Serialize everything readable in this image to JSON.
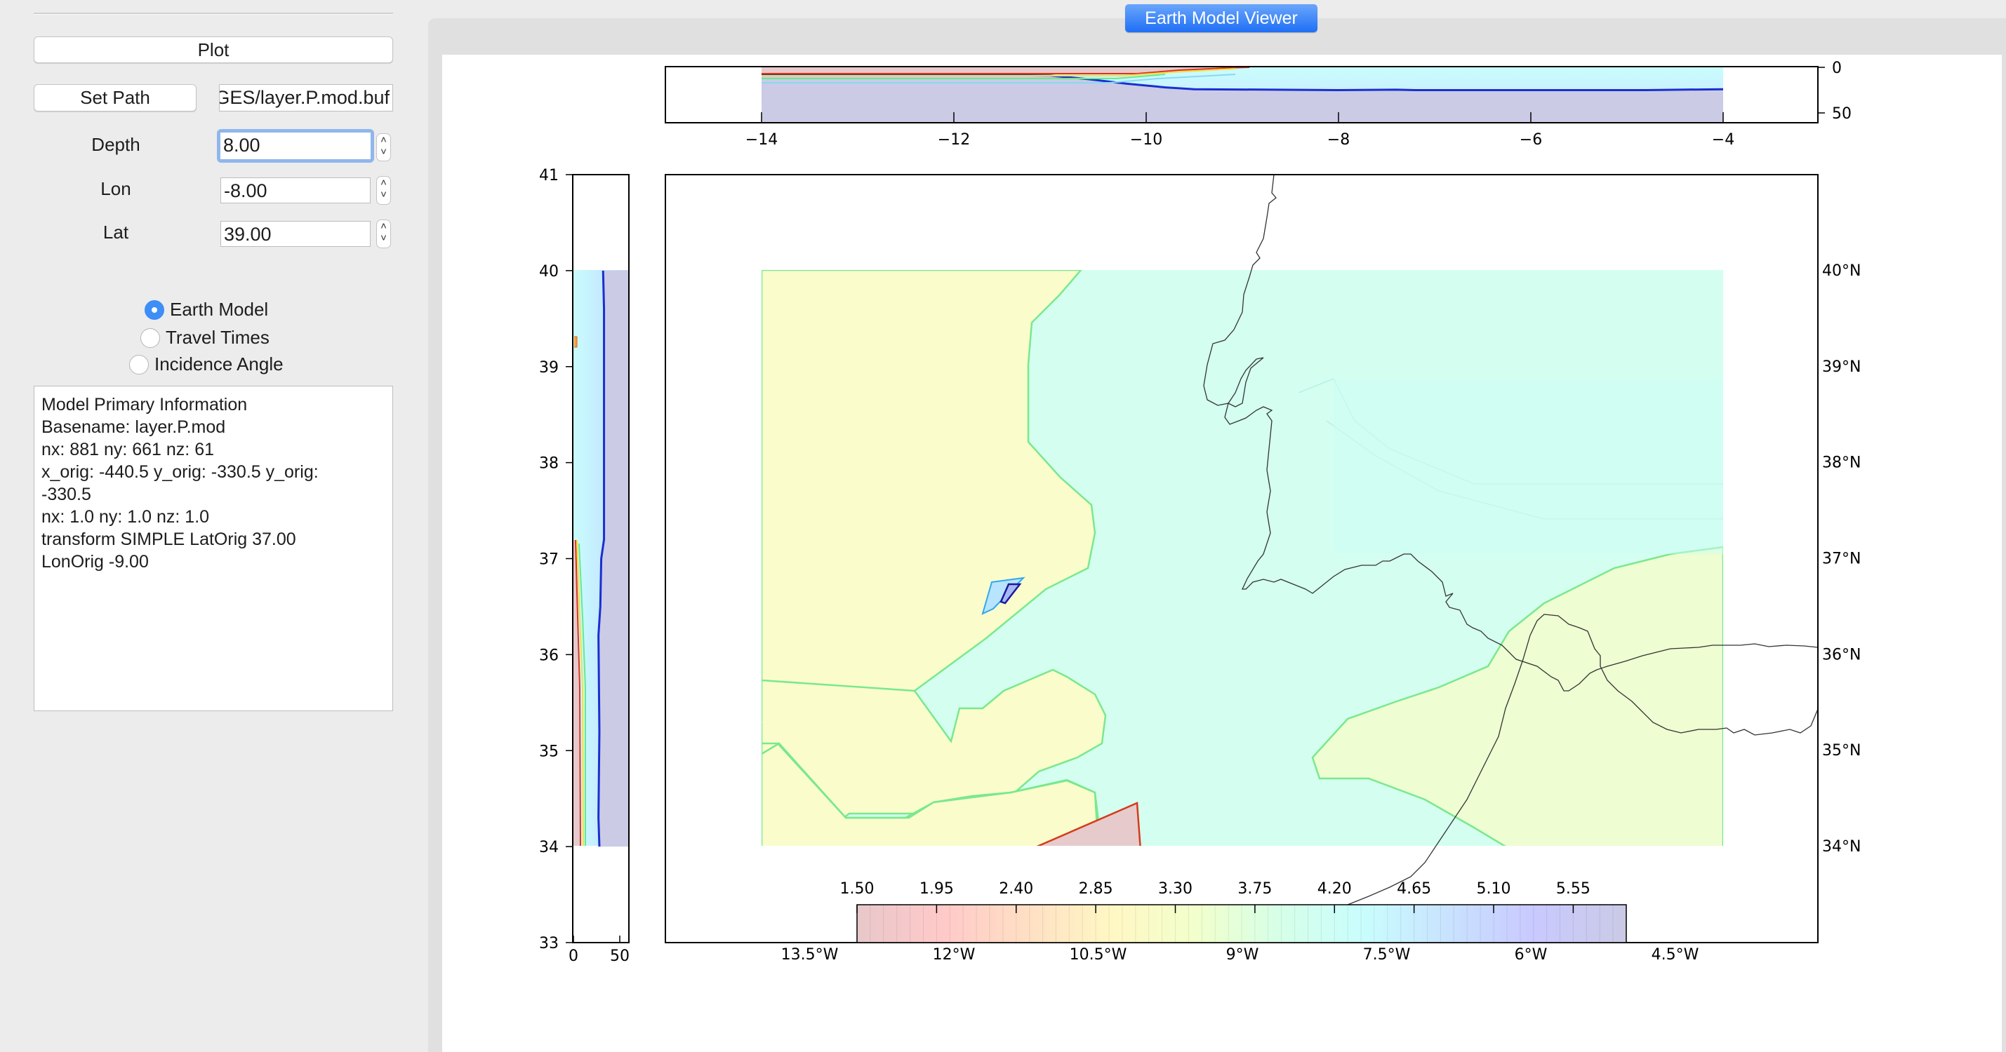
{
  "sidebar": {
    "plot_button": "Plot",
    "set_path_button": "Set Path",
    "path_value": "/Users/data/IMAGES/layer.P.mod.buf",
    "fields": [
      {
        "label": "Depth",
        "value": "8.00",
        "focused": true
      },
      {
        "label": "Lon",
        "value": "-8.00",
        "focused": false
      },
      {
        "label": "Lat",
        "value": "39.00",
        "focused": false
      }
    ],
    "spinner_up": "⌃",
    "spinner_down": "⌄",
    "radios": [
      {
        "label": "Earth Model",
        "checked": true
      },
      {
        "label": "Travel Times",
        "checked": false
      },
      {
        "label": "Incidence Angle",
        "checked": false
      }
    ],
    "info_lines": [
      "Model Primary Information",
      "Basename: layer.P.mod",
      "nx: 881 ny: 661 nz: 61",
      "x_orig: -440.5 y_orig: -330.5 y_orig:\n-330.5",
      "nx: 1.0 ny: 1.0 nz: 1.0",
      "transform SIMPLE LatOrig 37.00",
      "LonOrig -9.00"
    ]
  },
  "header": {
    "title": "Earth Model Viewer",
    "accent": "#1f6ff5"
  },
  "chart_data": [
    {
      "type": "heatmap",
      "name": "depth-section-lon",
      "title": "",
      "xlabel": "",
      "ylabel": "",
      "x_ticks": [
        "−14",
        "−12",
        "−10",
        "−8",
        "−6",
        "−4"
      ],
      "x_tick_values": [
        -14,
        -12,
        -10,
        -8,
        -6,
        -4
      ],
      "xlim": [
        -15,
        -2.9
      ],
      "y_ticks": [
        "0",
        "50"
      ],
      "y_tick_values": [
        0,
        50
      ],
      "ylim": [
        0,
        60
      ],
      "y_inverted": true,
      "y_axis_side": "right",
      "data_extent": {
        "x": [
          -14,
          -4
        ],
        "y": [
          0,
          60
        ]
      },
      "moho_depth_profile": {
        "lon": [
          -14,
          -11.7,
          -11,
          -10.6,
          -10.2,
          -9.8,
          -9.5,
          -8,
          -7.4,
          -7.2,
          -4.8,
          -4
        ],
        "depth": [
          8,
          8.5,
          9,
          13,
          18,
          22,
          24,
          25,
          24.5,
          25,
          25,
          24
        ]
      }
    },
    {
      "type": "heatmap",
      "name": "depth-section-lat",
      "y_ticks": [
        "33",
        "34",
        "35",
        "36",
        "37",
        "38",
        "39",
        "40",
        "41"
      ],
      "y_tick_values": [
        33,
        34,
        35,
        36,
        37,
        38,
        39,
        40,
        41
      ],
      "ylim": [
        33,
        41
      ],
      "x_ticks": [
        "0",
        "50"
      ],
      "x_tick_values": [
        0,
        50
      ],
      "xlim": [
        0,
        60
      ],
      "data_extent": {
        "lat": [
          34,
          40
        ],
        "depth": [
          0,
          60
        ]
      },
      "moho_depth_profile": {
        "lat": [
          34,
          34.3,
          35.2,
          36.2,
          36.5,
          37,
          37.2,
          39.6,
          40
        ],
        "depth": [
          28,
          27,
          28,
          27,
          29,
          30,
          33,
          33,
          32
        ]
      }
    },
    {
      "type": "heatmap",
      "name": "velocity-map",
      "title": "",
      "x_ticks": [
        "13.5°W",
        "12°W",
        "10.5°W",
        "9°W",
        "7.5°W",
        "6°W",
        "4.5°W"
      ],
      "x_tick_values": [
        -13.5,
        -12,
        -10.5,
        -9,
        -7.5,
        -6,
        -4.5
      ],
      "y_ticks": [
        "34°N",
        "35°N",
        "36°N",
        "37°N",
        "38°N",
        "39°N",
        "40°N"
      ],
      "y_tick_values": [
        34,
        35,
        36,
        37,
        38,
        39,
        40
      ],
      "lat_axis_side": "right",
      "data_extent": {
        "lon": [
          -14,
          -4
        ],
        "lat": [
          34,
          40
        ]
      },
      "depth_km": 8.0,
      "colorbar": {
        "orientation": "horizontal",
        "position": "bottom-center",
        "ticks": [
          "1.50",
          "1.95",
          "2.40",
          "2.85",
          "3.30",
          "3.75",
          "4.20",
          "4.65",
          "5.10",
          "5.55"
        ],
        "tick_values": [
          1.5,
          1.95,
          2.4,
          2.85,
          3.3,
          3.75,
          4.2,
          4.65,
          5.1,
          5.55
        ],
        "range": [
          1.5,
          5.85
        ],
        "colormap": [
          "#e8c8ca",
          "#ffc9c9",
          "#ffdfc4",
          "#fff7c4",
          "#f2ffcc",
          "#d6ffe8",
          "#c9fdfd",
          "#c9e2ff",
          "#c9c9ff",
          "#cacae6"
        ]
      },
      "regions": [
        {
          "name": "background-mid-velocity",
          "value": 3.9,
          "color": "#d4fff0"
        },
        {
          "name": "low-velocity-northwest",
          "value": 3.0,
          "color": "#fafdcb"
        },
        {
          "name": "low-velocity-southeast",
          "value": 3.3,
          "color": "#eefdd2"
        },
        {
          "name": "very-low-velocity-south",
          "value": 1.5,
          "color": "#e6cacc"
        },
        {
          "name": "high-velocity-anomaly",
          "value": 5.5,
          "color": "#b8d8ff"
        }
      ]
    }
  ]
}
